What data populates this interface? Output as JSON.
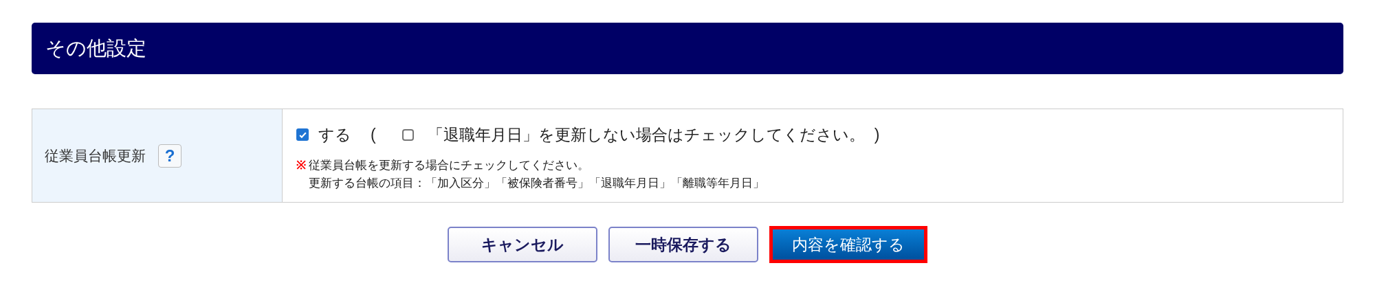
{
  "section": {
    "title": "その他設定"
  },
  "row": {
    "label": "従業員台帳更新",
    "help": "?",
    "main_option": {
      "label": "する",
      "checked": true
    },
    "paren_open": "(",
    "paren_close": ")",
    "sub_option": {
      "label": "「退職年月日」を更新しない場合はチェックしてください。",
      "checked": false
    },
    "note_mark": "※",
    "notes": [
      "従業員台帳を更新する場合にチェックしてください。",
      "更新する台帳の項目：「加入区分」「被保険者番号」「退職年月日」「離職等年月日」"
    ]
  },
  "buttons": [
    {
      "label": "キャンセル",
      "kind": "secondary",
      "highlighted": false
    },
    {
      "label": "一時保存する",
      "kind": "secondary",
      "highlighted": false
    },
    {
      "label": "内容を確認する",
      "kind": "primary",
      "highlighted": true
    }
  ]
}
